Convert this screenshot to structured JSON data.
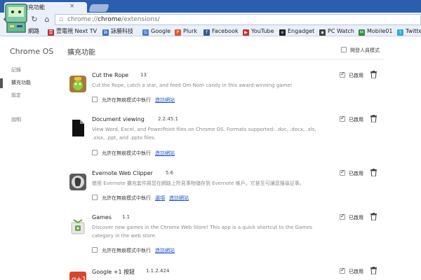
{
  "tab": {
    "title": "擴充功能",
    "close": "×"
  },
  "toolbar": {
    "back": "←",
    "forward": "→",
    "reload": "↻",
    "home": "⌂"
  },
  "omnibox": {
    "scheme": "chrome://",
    "host": "chrome",
    "path": "/extensions/",
    "icon": "page-icon"
  },
  "bookmarks": [
    {
      "label": "網路",
      "icon": "folder-icon"
    },
    {
      "label": "壹電視 Next TV",
      "icon": "nexttv-icon",
      "color": "#c0282d"
    },
    {
      "label": "詠勝科技",
      "icon": "weisheng-icon",
      "color": "#3a6fb7"
    },
    {
      "label": "Google",
      "icon": "google-icon",
      "color": "#4a7bd6"
    },
    {
      "label": "Plurk",
      "icon": "plurk-icon",
      "color": "#e0572b"
    },
    {
      "label": "Facebook",
      "icon": "facebook-icon",
      "color": "#3b5998"
    },
    {
      "label": "YouTube",
      "icon": "youtube-icon",
      "color": "#d22a2a"
    },
    {
      "label": "Engadget",
      "icon": "engadget-icon",
      "color": "#222222"
    },
    {
      "label": "PC Watch",
      "icon": "pcwatch-icon",
      "color": "#444444"
    },
    {
      "label": "Mobile01",
      "icon": "mobile01-icon",
      "color": "#2f8a3a"
    },
    {
      "label": "Twitte",
      "icon": "twitter-icon",
      "color": "#33a9e0"
    }
  ],
  "sidebar": {
    "brand": "Chrome OS",
    "items": [
      {
        "label": "記錄"
      },
      {
        "label": "擴充功能",
        "active": true
      },
      {
        "label": "設定"
      },
      {
        "label": "說明"
      }
    ]
  },
  "header": {
    "title": "擴充功能",
    "dev_mode_label": "開發人員模式"
  },
  "extensions": [
    {
      "name": "Cut the Rope",
      "version": "13",
      "description": "Cut the Rope, catch a star, and feed Om Nom candy in this award-winning game!",
      "incognito_label": "允許在無痕模式中執行",
      "options_label": "",
      "site_label": "造訪網站",
      "enabled_label": "已啟用",
      "icon": "cut-the-rope-icon"
    },
    {
      "name": "Document viewing",
      "version": "2.2.45.1",
      "description": "View Word, Excel, and PowerPoint files on Chrome OS. Formats supported: .doc, .docx, .xls, .xlsx, .ppt, and .pptx files.",
      "incognito_label": "允許在無痕模式中執行",
      "options_label": "",
      "site_label": "造訪網站",
      "enabled_label": "已啟用",
      "icon": "document-icon"
    },
    {
      "name": "Evernote Web Clipper",
      "version": "5.6",
      "description": "使用 Evernote 擴充套件將您在網路上所見事物儲存到 Evernote 帳戶。它甚至可讓您搜尋記事。",
      "incognito_label": "允許在無痕模式中執行",
      "options_label": "選項",
      "site_label": "造訪網站",
      "enabled_label": "已啟用",
      "icon": "evernote-icon"
    },
    {
      "name": "Games",
      "version": "1.1",
      "description": "Discover new games in the Chrome Web Store! This app is a quick shortcut to the Games category in the web store.",
      "incognito_label": "允許在無痕模式中執行",
      "options_label": "",
      "site_label": "造訪網站",
      "enabled_label": "已啟用",
      "icon": "games-icon"
    },
    {
      "name": "Google +1 按鈕",
      "version": "1.1.2.424",
      "description": "",
      "incognito_label": "",
      "options_label": "",
      "site_label": "",
      "enabled_label": "已啟用",
      "icon": "google-plus-one-icon"
    }
  ]
}
